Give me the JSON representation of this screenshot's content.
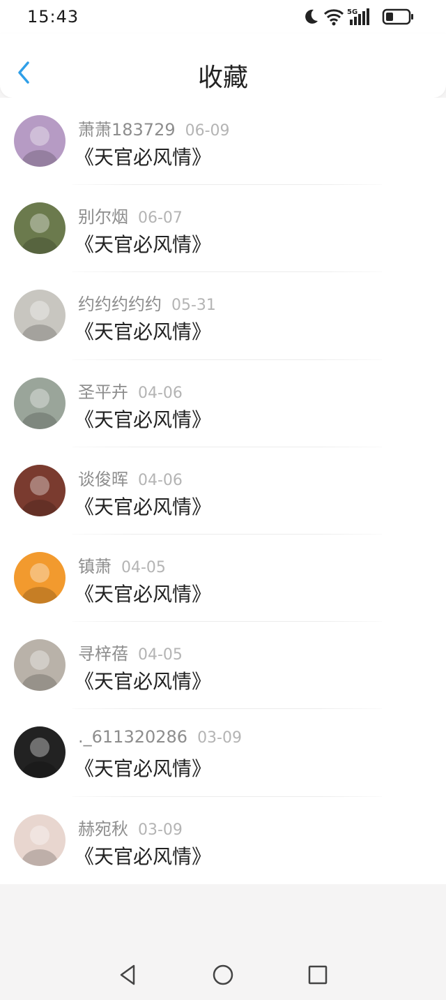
{
  "status_bar": {
    "time": "15:43",
    "icons": [
      "moon-icon",
      "wifi-icon",
      "signal-5g-icon",
      "battery-icon"
    ],
    "network_label": "5G"
  },
  "header": {
    "title": "收藏",
    "back_icon": "chevron-left-icon",
    "accent_color": "#2f9fe8"
  },
  "favorites": [
    {
      "username": "萧萧183729",
      "date": "06-09",
      "content": "《天官必风情》",
      "avatar_color": "#b69bc4"
    },
    {
      "username": "别尔烟",
      "date": "06-07",
      "content": "《天官必风情》",
      "avatar_color": "#6b7a4d"
    },
    {
      "username": "约约约约约",
      "date": "05-31",
      "content": "《天官必风情》",
      "avatar_color": "#c8c6c0"
    },
    {
      "username": "圣平卉",
      "date": "04-06",
      "content": "《天官必风情》",
      "avatar_color": "#9aa59a"
    },
    {
      "username": "谈俊晖",
      "date": "04-06",
      "content": "《天官必风情》",
      "avatar_color": "#7a3b2f"
    },
    {
      "username": "镇萧",
      "date": "04-05",
      "content": "《天官必风情》",
      "avatar_color": "#f29a2e"
    },
    {
      "username": "寻梓蓓",
      "date": "04-05",
      "content": "《天官必风情》",
      "avatar_color": "#b9b2a9"
    },
    {
      "username": "._611320286",
      "date": "03-09",
      "content": "《天官必风情》",
      "avatar_color": "#222222"
    },
    {
      "username": "赫宛秋",
      "date": "03-09",
      "content": "《天官必风情》",
      "avatar_color": "#e8d6cf"
    }
  ],
  "nav_bar": {
    "buttons": [
      "back-triangle-icon",
      "home-circle-icon",
      "recents-square-icon"
    ]
  }
}
